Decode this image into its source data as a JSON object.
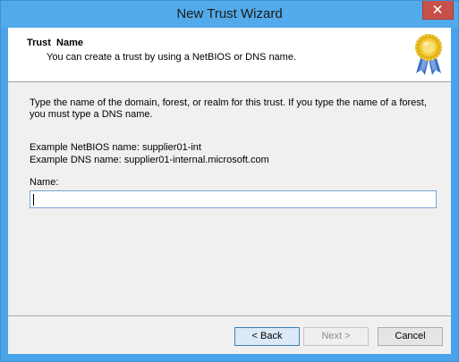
{
  "window": {
    "title": "New Trust Wizard",
    "close_icon": "close-icon"
  },
  "header": {
    "title": "Trust  Name",
    "subtitle": "You can create a trust by using a NetBIOS or DNS name.",
    "badge_icon": "award-ribbon-icon"
  },
  "body": {
    "instructions": "Type the name of the domain, forest, or realm for this trust. If you type the name of a forest, you must type a DNS name.",
    "example_netbios": "Example NetBIOS name: supplier01-int",
    "example_dns": "Example DNS name: supplier01-internal.microsoft.com",
    "name_label": "Name:",
    "name_value": ""
  },
  "buttons": {
    "back": "< Back",
    "next": "Next >",
    "cancel": "Cancel"
  },
  "colors": {
    "titlebar": "#53aaea",
    "close": "#c7504b",
    "client": "#f0f0f0",
    "input_border": "#7aa7d2"
  }
}
